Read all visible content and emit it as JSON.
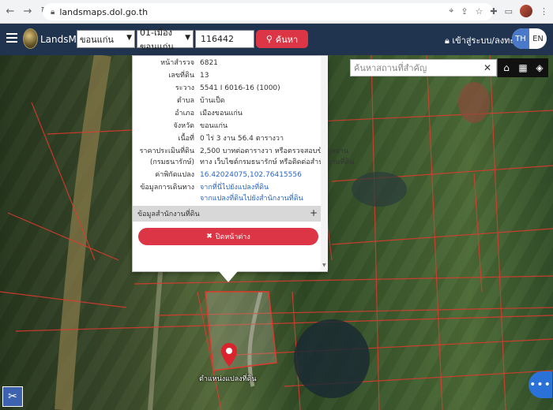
{
  "browser": {
    "url": "landsmaps.dol.go.th"
  },
  "header": {
    "brand": "LandsMaps",
    "province_select": "ขอนแก่น",
    "district_select": "01-เมืองขอนแก่น",
    "parcel_no": "116442",
    "search_label": "ค้นหา",
    "login_label": "เข้าสู่ระบบ/ลงทะเบียน",
    "lang_th": "TH",
    "lang_en": "EN"
  },
  "map": {
    "search_placeholder": "ค้นหาสถานที่สำคัญ",
    "pin_label": "ตำแหน่งแปลงที่ดิน"
  },
  "panel": {
    "rows": [
      {
        "label": "หน้าสำรวจ",
        "value": "6821"
      },
      {
        "label": "เลขที่ดิน",
        "value": "13"
      },
      {
        "label": "ระวาง",
        "value": "5541 I 6016-16 (1000)"
      },
      {
        "label": "ตำบล",
        "value": "บ้านเป็ด"
      },
      {
        "label": "อำเภอ",
        "value": "เมืองขอนแก่น"
      },
      {
        "label": "จังหวัด",
        "value": "ขอนแก่น"
      },
      {
        "label": "เนื้อที่",
        "value": "0 ไร่ 3 งาน 56.4 ตารางวา"
      },
      {
        "label": "ราคาประเมินที่ดิน",
        "value": "2,500 บาทต่อตารางวา หรือตรวจสอบข้อมูลผ่าน"
      },
      {
        "label": "(กรมธนารักษ์)",
        "value": "ทาง เว็บไซต์กรมธนารักษ์ หรือติดต่อสำนักงานที่ดิน"
      },
      {
        "label": "ค่าพิกัดแปลง",
        "value": "16.42024075,102.76415556"
      },
      {
        "label": "ข้อมูลการเดินทาง",
        "value": "จากที่นี่ไปยังแปลงที่ดิน"
      },
      {
        "label": "",
        "value": "จากแปลงที่ดินไปยังสำนักงานที่ดิน"
      }
    ],
    "section_title": "ข้อมูลสำนักงานที่ดิน",
    "close_label": "ปิดหน้าต่าง"
  },
  "colors": {
    "header_bg": "#21344f",
    "accent_red": "#dc3545",
    "link_blue": "#2b66c2",
    "parcel_line": "#e03a2f"
  },
  "icons": [
    "back-icon",
    "forward-icon",
    "reload-icon",
    "lock-icon",
    "location-icon",
    "share-icon",
    "star-icon",
    "puzzle-icon",
    "menu-icon",
    "search-icon",
    "user-icon",
    "close-icon",
    "home-icon",
    "table-icon",
    "layers-icon",
    "plus-icon",
    "map-pin-icon",
    "tools-icon",
    "more-icon"
  ]
}
